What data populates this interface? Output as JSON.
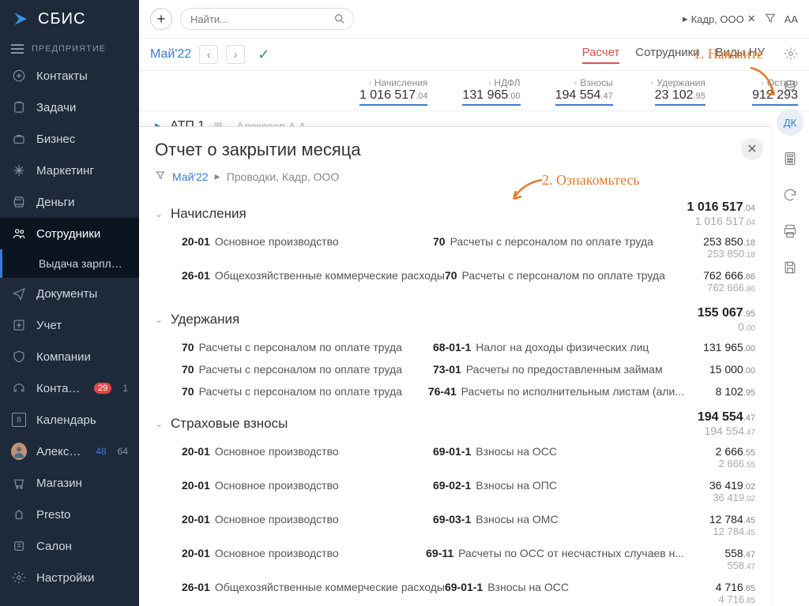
{
  "brand": "СБИС",
  "org_label": "ПРЕДПРИЯТИЕ",
  "sidebar": {
    "items": [
      {
        "label": "Контакты"
      },
      {
        "label": "Задачи"
      },
      {
        "label": "Бизнес"
      },
      {
        "label": "Маркетинг"
      },
      {
        "label": "Деньги"
      },
      {
        "label": "Сотрудники"
      },
      {
        "label": "Выдача зарплат..."
      },
      {
        "label": "Документы"
      },
      {
        "label": "Учет"
      },
      {
        "label": "Компании"
      },
      {
        "label": "Контакт-це...",
        "badge_red": "29",
        "badge_gray": "1"
      },
      {
        "label": "Календарь",
        "cal_day": "8"
      },
      {
        "label": "Алексеев",
        "badge_blue": "48",
        "badge_gray": "64"
      },
      {
        "label": "Магазин"
      },
      {
        "label": "Presto"
      },
      {
        "label": "Салон"
      },
      {
        "label": "Настройки"
      }
    ]
  },
  "search": {
    "placeholder": "Найти..."
  },
  "top_org": "Кадр, ООО",
  "font_label": "AA",
  "period": "Май'22",
  "tabs": {
    "t1": "Расчет",
    "t2": "Сотрудники",
    "t3": "Виды НУ"
  },
  "summary": {
    "heads": {
      "h1": "Начисления",
      "h2": "НДФЛ",
      "h3": "Взносы",
      "h4": "Удержания",
      "h5": "Остато"
    },
    "v1": "1 016 517",
    "v1d": ".04",
    "v2": "131 965",
    "v2d": ".00",
    "v3": "194 554",
    "v3d": ".47",
    "v4": "23 102",
    "v4d": ".95",
    "v5": "912 293"
  },
  "atp": {
    "label": "АТП 1",
    "person": "Алексеев А.А."
  },
  "panel": {
    "title": "Отчет о закрытии месяца",
    "month": "Май'22",
    "crumb": "Проводки, Кадр, ООО"
  },
  "rail_dk": "ДК",
  "annot": {
    "a1": "1. Нажмите",
    "a2": "2. Ознакомьтесь"
  },
  "groups": [
    {
      "title": "Начисления",
      "sum1": "1 016 517",
      "sum1d": ".04",
      "sum2": "1 016 517",
      "sum2d": ".04",
      "rows": [
        {
          "c1": "20-01",
          "d1": "Основное производство",
          "c2": "70",
          "d2": "Расчеты с персоналом по оплате труда",
          "a1": "253 850",
          "a1d": ".18",
          "a2": "253 850",
          "a2d": ".18"
        },
        {
          "c1": "26-01",
          "d1": "Общехозяйственные коммерческие расходы",
          "c2": "70",
          "d2": "Расчеты с персоналом по оплате труда",
          "a1": "762 666",
          "a1d": ".86",
          "a2": "762 666",
          "a2d": ".86"
        }
      ]
    },
    {
      "title": "Удержания",
      "sum1": "155 067",
      "sum1d": ".95",
      "sum2": "0",
      "sum2d": ".00",
      "rows": [
        {
          "c1": "70",
          "d1": "Расчеты с персоналом по оплате труда",
          "c2": "68-01-1",
          "d2": "Налог на доходы физических лиц",
          "a1": "131 965",
          "a1d": ".00"
        },
        {
          "c1": "70",
          "d1": "Расчеты с персоналом по оплате труда",
          "c2": "73-01",
          "d2": "Расчеты по предоставленным займам",
          "a1": "15 000",
          "a1d": ".00"
        },
        {
          "c1": "70",
          "d1": "Расчеты с персоналом по оплате труда",
          "c2": "76-41",
          "d2": "Расчеты по исполнительным листам (али...",
          "a1": "8 102",
          "a1d": ".95"
        }
      ]
    },
    {
      "title": "Страховые взносы",
      "sum1": "194 554",
      "sum1d": ".47",
      "sum2": "194 554",
      "sum2d": ".47",
      "rows": [
        {
          "c1": "20-01",
          "d1": "Основное производство",
          "c2": "69-01-1",
          "d2": "Взносы на ОСС",
          "a1": "2 666",
          "a1d": ".55",
          "a2": "2 666",
          "a2d": ".55"
        },
        {
          "c1": "20-01",
          "d1": "Основное производство",
          "c2": "69-02-1",
          "d2": "Взносы на ОПС",
          "a1": "36 419",
          "a1d": ".02",
          "a2": "36 419",
          "a2d": ".02"
        },
        {
          "c1": "20-01",
          "d1": "Основное производство",
          "c2": "69-03-1",
          "d2": "Взносы на ОМС",
          "a1": "12 784",
          "a1d": ".45",
          "a2": "12 784",
          "a2d": ".45"
        },
        {
          "c1": "20-01",
          "d1": "Основное производство",
          "c2": "69-11",
          "d2": "Расчеты по ОСС от несчастных случаев н...",
          "a1": "558",
          "a1d": ".47",
          "a2": "558",
          "a2d": ".47"
        },
        {
          "c1": "26-01",
          "d1": "Общехозяйственные коммерческие расходы",
          "c2": "69-01-1",
          "d2": "Взносы на ОСС",
          "a1": "4 716",
          "a1d": ".85",
          "a2": "4 716",
          "a2d": ".85"
        }
      ]
    }
  ]
}
